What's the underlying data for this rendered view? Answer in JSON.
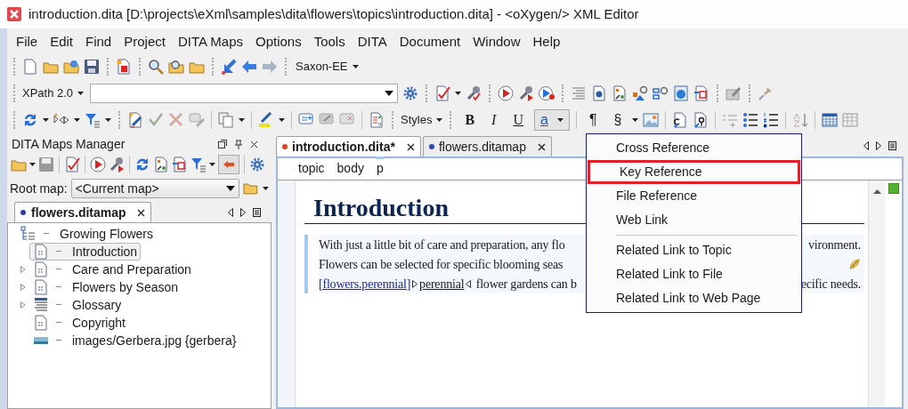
{
  "window": {
    "title": "introduction.dita [D:\\projects\\eXml\\samples\\dita\\flowers\\topics\\introduction.dita] - <oXygen/> XML Editor"
  },
  "menu_bar": [
    "File",
    "Edit",
    "Find",
    "Project",
    "DITA Maps",
    "Options",
    "Tools",
    "DITA",
    "Document",
    "Window",
    "Help"
  ],
  "toolbar": {
    "processor": "Saxon-EE",
    "xpath_version": "XPath 2.0",
    "styles": "Styles",
    "format_buttons": [
      {
        "label": "B",
        "kind": "bold",
        "pressed": false
      },
      {
        "label": "I",
        "kind": "italic",
        "pressed": false
      },
      {
        "label": "U",
        "kind": "underline",
        "pressed": false
      },
      {
        "label": "a",
        "kind": "link",
        "pressed": true
      },
      {
        "label": "¶",
        "kind": "paragraph",
        "pressed": false
      },
      {
        "label": "§",
        "kind": "section",
        "pressed": false
      }
    ]
  },
  "dita_maps_manager": {
    "title": "DITA Maps Manager",
    "root_map_label": "Root map:",
    "root_map": "<Current map>",
    "tabs": [
      {
        "label": "flowers.ditamap",
        "selected": true,
        "color": "#2a3fa8"
      }
    ],
    "tree": [
      {
        "label": "Growing Flowers",
        "kind": "map",
        "selected": false,
        "expandable": false,
        "children": [
          {
            "label": "Introduction",
            "kind": "topic",
            "selected": true,
            "expandable": false
          },
          {
            "label": "Care and Preparation",
            "kind": "topic",
            "selected": false,
            "expandable": true
          },
          {
            "label": "Flowers by Season",
            "kind": "topic",
            "selected": false,
            "expandable": true
          },
          {
            "label": "Glossary",
            "kind": "glossary",
            "selected": false,
            "expandable": true
          },
          {
            "label": "Copyright",
            "kind": "topic",
            "selected": false,
            "expandable": false
          },
          {
            "label": "images/Gerbera.jpg {gerbera}",
            "kind": "image",
            "selected": false,
            "expandable": false
          }
        ]
      }
    ]
  },
  "editor": {
    "tabs": [
      {
        "label": "introduction.dita*",
        "selected": true,
        "color": "#e0401a"
      },
      {
        "label": "flowers.ditamap",
        "selected": false,
        "color": "#2a4ab0"
      }
    ],
    "breadcrumb": [
      {
        "label": "topic",
        "selected": false
      },
      {
        "label": "body",
        "selected": false
      },
      {
        "label": "p",
        "selected": true
      }
    ],
    "heading": "Introduction",
    "paragraph_lines": [
      {
        "left": [
          {
            "kind": "text",
            "text": "With just a little bit of care and preparation, any flo"
          }
        ],
        "right": [
          {
            "kind": "text",
            "text": "vironment."
          }
        ]
      },
      {
        "left": [
          {
            "kind": "text",
            "text": "Flowers can be selected for specific blooming seas"
          }
        ],
        "right": [
          {
            "kind": "marker"
          }
        ]
      },
      {
        "left": [
          {
            "kind": "link",
            "text": "[flowers.perennial]"
          },
          {
            "kind": "tag_start"
          },
          {
            "kind": "keyword",
            "text": "perennial"
          },
          {
            "kind": "tag_end"
          },
          {
            "kind": "text",
            "text": " flower gardens can b"
          }
        ],
        "right": [
          {
            "kind": "text",
            "text": "ecific needs."
          }
        ]
      }
    ]
  },
  "context_menu": {
    "items": [
      {
        "kind": "item",
        "label": "Cross Reference",
        "highlighted": false
      },
      {
        "kind": "item",
        "label": "Key Reference",
        "highlighted": true
      },
      {
        "kind": "item",
        "label": "File Reference",
        "highlighted": false
      },
      {
        "kind": "item",
        "label": "Web Link",
        "highlighted": false
      },
      {
        "kind": "separator"
      },
      {
        "kind": "item",
        "label": "Related Link to Topic",
        "highlighted": false
      },
      {
        "kind": "item",
        "label": "Related Link to File",
        "highlighted": false
      },
      {
        "kind": "item",
        "label": "Related Link to Web Page",
        "highlighted": false
      }
    ]
  }
}
